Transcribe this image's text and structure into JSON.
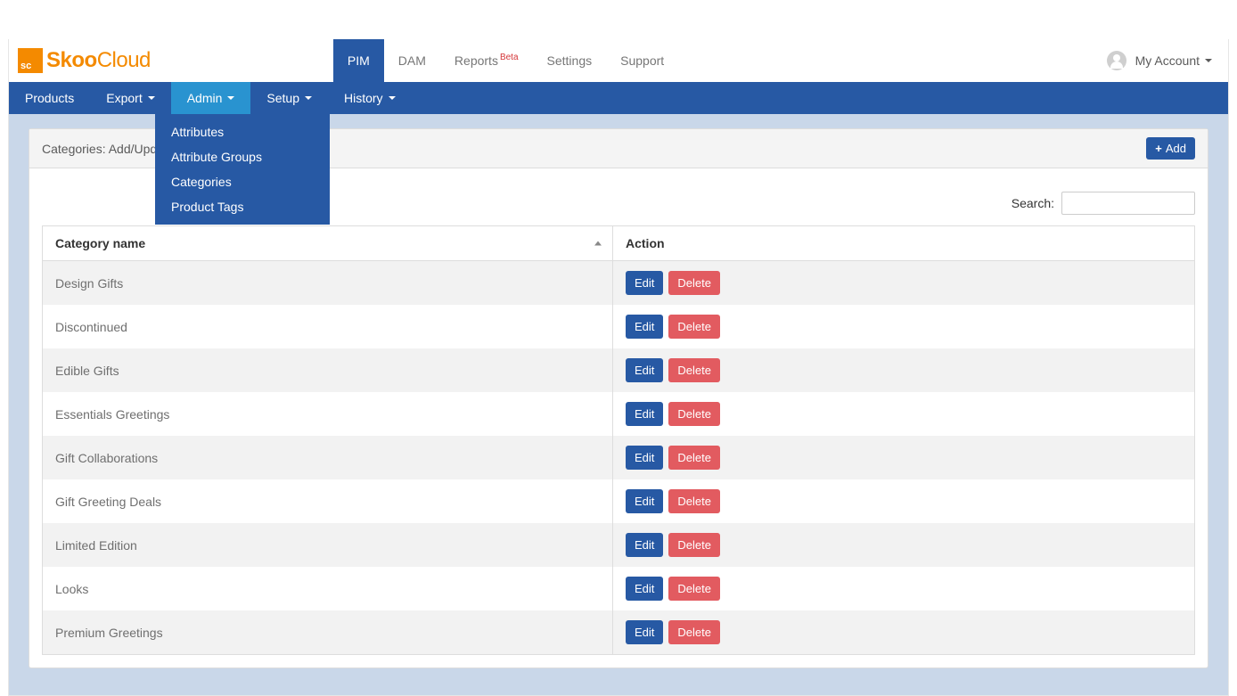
{
  "brand": {
    "sq": "sc",
    "name_bold": "Skoo",
    "name_light": "Cloud"
  },
  "top_nav": {
    "tabs": [
      {
        "label": "PIM",
        "active": true
      },
      {
        "label": "DAM"
      },
      {
        "label": "Reports",
        "beta": "Beta"
      },
      {
        "label": "Settings"
      },
      {
        "label": "Support"
      }
    ],
    "account_label": "My Account"
  },
  "sub_nav": {
    "items": [
      {
        "label": "Products"
      },
      {
        "label": "Export",
        "caret": true
      },
      {
        "label": "Admin",
        "caret": true,
        "active": true
      },
      {
        "label": "Setup",
        "caret": true
      },
      {
        "label": "History",
        "caret": true
      }
    ]
  },
  "admin_menu": [
    "Attributes",
    "Attribute Groups",
    "Categories",
    "Product Tags"
  ],
  "panel": {
    "title": "Categories: Add/Update/Delete",
    "add_label": "Add",
    "search_label": "Search:"
  },
  "table": {
    "col_name": "Category name",
    "col_action": "Action",
    "edit_label": "Edit",
    "delete_label": "Delete",
    "rows": [
      "Design Gifts",
      "Discontinued",
      "Edible Gifts",
      "Essentials Greetings",
      "Gift Collaborations",
      "Gift Greeting Deals",
      "Limited Edition",
      "Looks",
      "Premium Greetings"
    ]
  }
}
